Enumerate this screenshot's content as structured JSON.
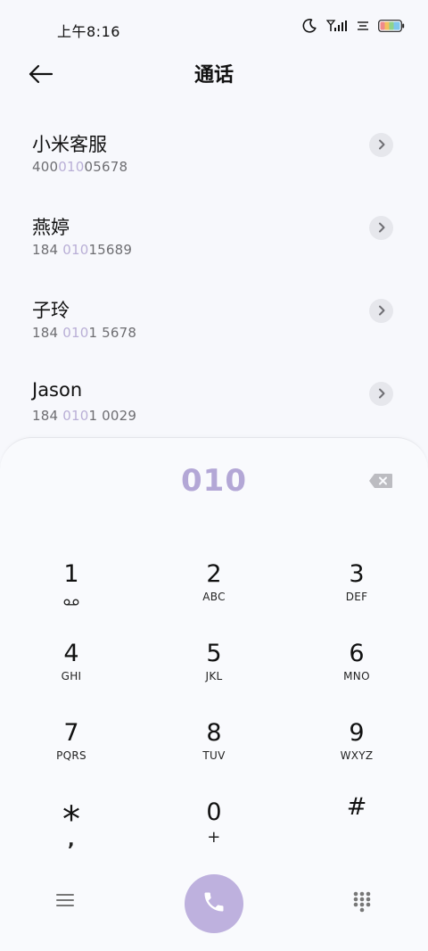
{
  "status_bar": {
    "time": "上午8:16",
    "icons": [
      "moon-icon",
      "signal-icon",
      "wifi-icon",
      "battery-icon"
    ]
  },
  "header": {
    "title": "通话",
    "back_icon": "arrow-left-icon"
  },
  "contacts": [
    {
      "name": "小米客服",
      "number_pre": "400",
      "number_match": "010",
      "number_post": "05678"
    },
    {
      "name": "燕婷",
      "number_pre": "184 ",
      "number_match": "010",
      "number_post": "15689"
    },
    {
      "name": "子玲",
      "number_pre": "184 ",
      "number_match": "010",
      "number_post": "1 5678"
    },
    {
      "name": "Jason",
      "number_pre": "184 ",
      "number_match": "010",
      "number_post": "1 0029"
    }
  ],
  "dialer": {
    "input_value": "010",
    "keys": [
      {
        "digit": "1",
        "letters": ""
      },
      {
        "digit": "2",
        "letters": "ABC"
      },
      {
        "digit": "3",
        "letters": "DEF"
      },
      {
        "digit": "4",
        "letters": "GHI"
      },
      {
        "digit": "5",
        "letters": "JKL"
      },
      {
        "digit": "6",
        "letters": "MNO"
      },
      {
        "digit": "7",
        "letters": "PQRS"
      },
      {
        "digit": "8",
        "letters": "TUV"
      },
      {
        "digit": "9",
        "letters": "WXYZ"
      },
      {
        "digit": "*",
        "letters": ","
      },
      {
        "digit": "0",
        "letters": "+"
      },
      {
        "digit": "#",
        "letters": ""
      }
    ]
  },
  "colors": {
    "accent": "#beb1de",
    "match_highlight": "#b9afd6",
    "display_text": "#b3a7d6"
  }
}
